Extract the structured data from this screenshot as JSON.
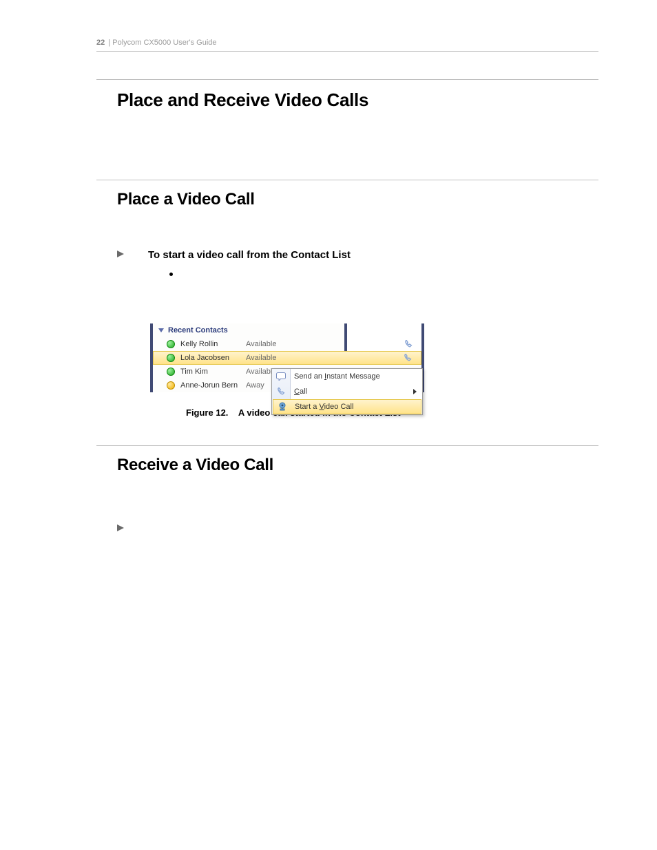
{
  "header": {
    "page_num": "22",
    "sep": " | ",
    "guide": "Polycom CX5000 User's Guide"
  },
  "h1": "Place and Receive Video Calls",
  "h2_a": "Place a Video Call",
  "proc_a": "To start a video call from the Contact List",
  "figure": {
    "group_header": "Recent Contacts",
    "rows": [
      {
        "name": "Kelly Rollin",
        "status": "Available",
        "presence": "avail",
        "phone": true,
        "selected": false
      },
      {
        "name": "Lola Jacobsen",
        "status": "Available",
        "presence": "avail",
        "phone": true,
        "selected": true
      },
      {
        "name": "Tim Kim",
        "status": "Available",
        "presence": "avail",
        "phone": false,
        "selected": false
      },
      {
        "name": "Anne-Jorun Bern",
        "status": "Away",
        "presence": "away",
        "phone": false,
        "selected": false
      }
    ],
    "menu": {
      "im": {
        "pre": "Send an ",
        "key": "I",
        "post": "nstant Message"
      },
      "call": {
        "pre": "",
        "key": "C",
        "post": "all"
      },
      "video": {
        "pre": "Start a ",
        "key": "V",
        "post": "ideo Call"
      }
    }
  },
  "figcap_num": "Figure 12.",
  "figcap_txt": "A video call started in the Contact List",
  "h2_b": "Receive a Video Call"
}
